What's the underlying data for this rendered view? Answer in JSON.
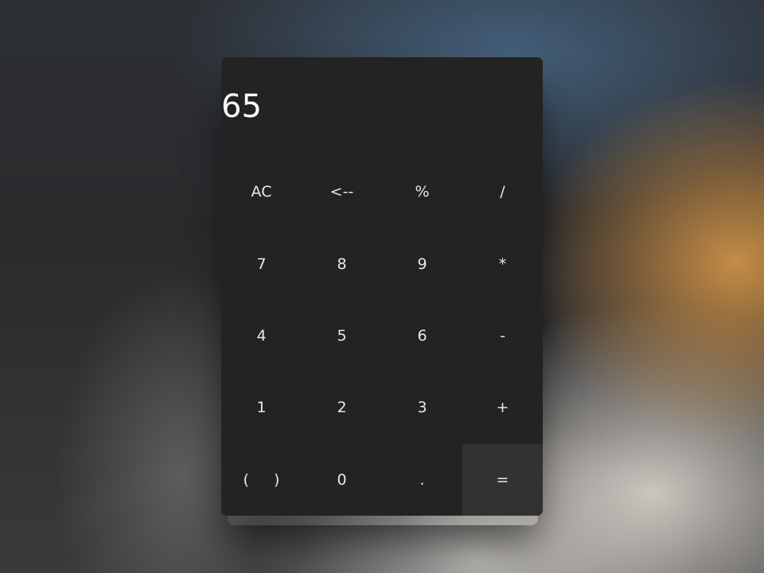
{
  "display": {
    "value": "65"
  },
  "keypad": {
    "ac": "AC",
    "backspace": "<--",
    "percent": "%",
    "divide": "/",
    "seven": "7",
    "eight": "8",
    "nine": "9",
    "multiply": "*",
    "four": "4",
    "five": "5",
    "six": "6",
    "subtract": "-",
    "one": "1",
    "two": "2",
    "three": "3",
    "add": "+",
    "open_paren": "(",
    "close_paren": ")",
    "zero": "0",
    "decimal": ".",
    "equals": "="
  },
  "colors": {
    "panel": "#232323",
    "equals_key": "#323232",
    "text": "#ffffff"
  }
}
